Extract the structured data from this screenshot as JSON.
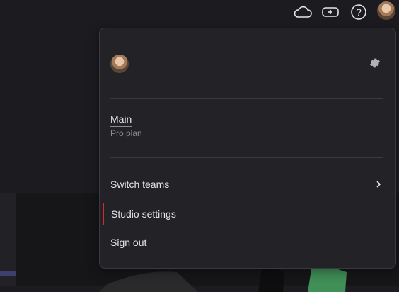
{
  "topbar": {
    "icons": [
      "cloud-icon",
      "gamepad-icon",
      "help-icon",
      "user-avatar"
    ],
    "help_glyph": "?"
  },
  "menu": {
    "settings_icon": "gear-icon",
    "team": {
      "name": "Main",
      "plan": "Pro plan"
    },
    "items": [
      {
        "label": "Switch teams",
        "icon": "chevron-right-icon"
      },
      {
        "label": "Studio settings",
        "highlighted": true,
        "highlight_color": "#d8262f"
      },
      {
        "label": "Sign out"
      }
    ]
  }
}
